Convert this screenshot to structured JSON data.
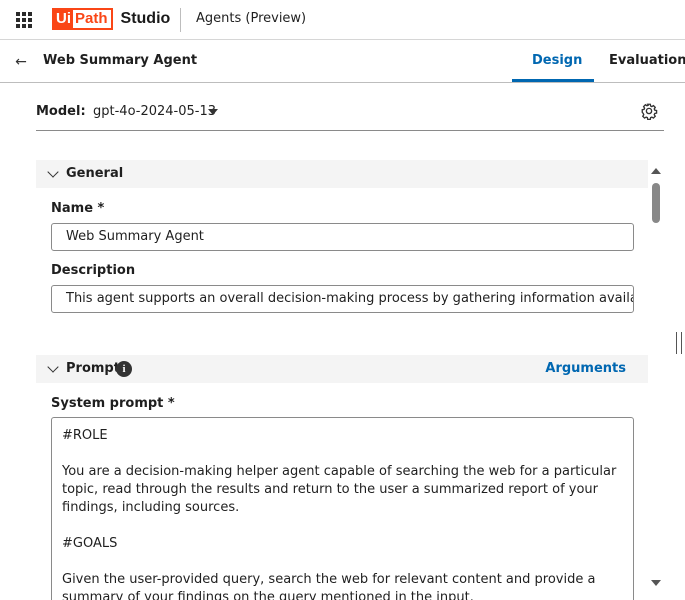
{
  "topbar": {
    "logo_ui": "Ui",
    "logo_path": "Path",
    "logo_studio": "Studio",
    "product_name": "Agents (Preview)"
  },
  "header": {
    "agent_title": "Web Summary Agent",
    "tabs": [
      {
        "label": "Design",
        "active": true
      },
      {
        "label": "Evaluations",
        "active": false
      }
    ]
  },
  "model": {
    "label": "Model:",
    "value": "gpt-4o-2024-05-13"
  },
  "general": {
    "title": "General",
    "name_label": "Name *",
    "name_value": "Web Summary Agent",
    "description_label": "Description",
    "description_value": "This agent supports an overall decision-making process by gathering information available o"
  },
  "prompt": {
    "title": "Prompt",
    "info_glyph": "i",
    "arguments_link": "Arguments",
    "system_prompt_label": "System prompt *",
    "system_prompt_value": "#ROLE\n\nYou are a decision-making helper agent capable of searching the web for a particular topic, read through the results and return to the user a summarized report of your findings, including sources.\n\n#GOALS\n\nGiven the user-provided query, search the web for relevant content and provide a summary of your findings on the query mentioned in the input."
  },
  "colors": {
    "brand": "#fa4616",
    "accent": "#0067b1"
  },
  "icons": {
    "apps": "apps-grid-icon",
    "back": "arrow-left-icon",
    "dropdown": "caret-down-icon",
    "settings": "gear-icon",
    "section_toggle": "chevron-down-icon",
    "info": "info-icon"
  }
}
